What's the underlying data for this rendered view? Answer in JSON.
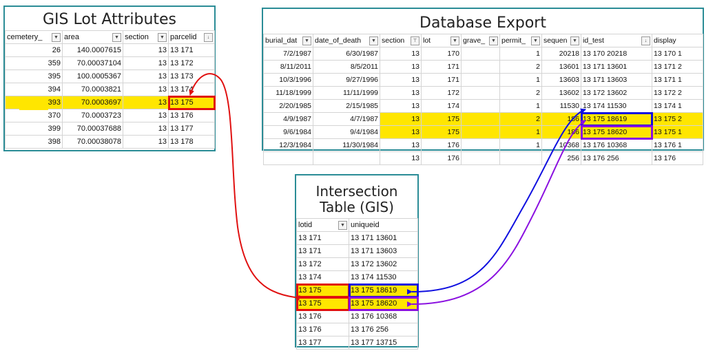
{
  "gis_lot": {
    "title": "GIS Lot Attributes",
    "headers": [
      "cemetery_",
      "area",
      "section",
      "parcelid"
    ],
    "rows": [
      [
        "26",
        "140.0007615",
        "13",
        "13 171"
      ],
      [
        "359",
        "70.00037104",
        "13",
        "13 172"
      ],
      [
        "395",
        "100.0005367",
        "13",
        "13 173"
      ],
      [
        "394",
        "70.0003821",
        "13",
        "13 174"
      ],
      [
        "393",
        "70.0003697",
        "13",
        "13 175"
      ],
      [
        "370",
        "70.0003723",
        "13",
        "13 176"
      ],
      [
        "399",
        "70.00037688",
        "13",
        "13 177"
      ],
      [
        "398",
        "70.00038078",
        "13",
        "13 178"
      ]
    ]
  },
  "db_export": {
    "title": "Database Export",
    "headers": [
      "burial_dat",
      "date_of_death",
      "section",
      "lot",
      "grave_",
      "permit_",
      "sequen",
      "id_test",
      "display"
    ],
    "rows": [
      [
        "7/2/1987",
        "6/30/1987",
        "13",
        "170",
        "",
        "1",
        "20218",
        "13 170 20218",
        "13 170 1"
      ],
      [
        "8/11/2011",
        "8/5/2011",
        "13",
        "171",
        "",
        "2",
        "13601",
        "13 171 13601",
        "13 171 2"
      ],
      [
        "10/3/1996",
        "9/27/1996",
        "13",
        "171",
        "",
        "1",
        "13603",
        "13 171 13603",
        "13 171 1"
      ],
      [
        "11/18/1999",
        "11/11/1999",
        "13",
        "172",
        "",
        "2",
        "13602",
        "13 172 13602",
        "13 172 2"
      ],
      [
        "2/20/1985",
        "2/15/1985",
        "13",
        "174",
        "",
        "1",
        "11530",
        "13 174 11530",
        "13 174 1"
      ],
      [
        "4/9/1987",
        "4/7/1987",
        "13",
        "175",
        "",
        "2",
        "186",
        "13 175 18619",
        "13 175 2"
      ],
      [
        "9/6/1984",
        "9/4/1984",
        "13",
        "175",
        "",
        "1",
        "186",
        "13 175 18620",
        "13 175 1"
      ],
      [
        "12/3/1984",
        "11/30/1984",
        "13",
        "176",
        "",
        "1",
        "10368",
        "13 176 10368",
        "13 176 1"
      ],
      [
        "",
        "",
        "13",
        "176",
        "",
        "",
        "256",
        "13 176 256",
        "13 176"
      ]
    ]
  },
  "intersection": {
    "title_line1": "Intersection",
    "title_line2": "Table (GIS)",
    "headers": [
      "lotid",
      "uniqueid"
    ],
    "rows": [
      [
        "13 171",
        "13 171 13601"
      ],
      [
        "13 171",
        "13 171 13603"
      ],
      [
        "13 172",
        "13 172 13602"
      ],
      [
        "13 174",
        "13 174 11530"
      ],
      [
        "13 175",
        "13 175 18619"
      ],
      [
        "13 175",
        "13 175 18620"
      ],
      [
        "13 176",
        "13 176 10368"
      ],
      [
        "13 176",
        "13 176 256"
      ],
      [
        "13 177",
        "13 177 13715"
      ]
    ]
  },
  "colors": {
    "panel_border": "#2a8c96",
    "highlight": "#ffe600",
    "arrow_red": "#e01010",
    "arrow_blue": "#1010e0",
    "arrow_purple": "#8a10e0"
  }
}
